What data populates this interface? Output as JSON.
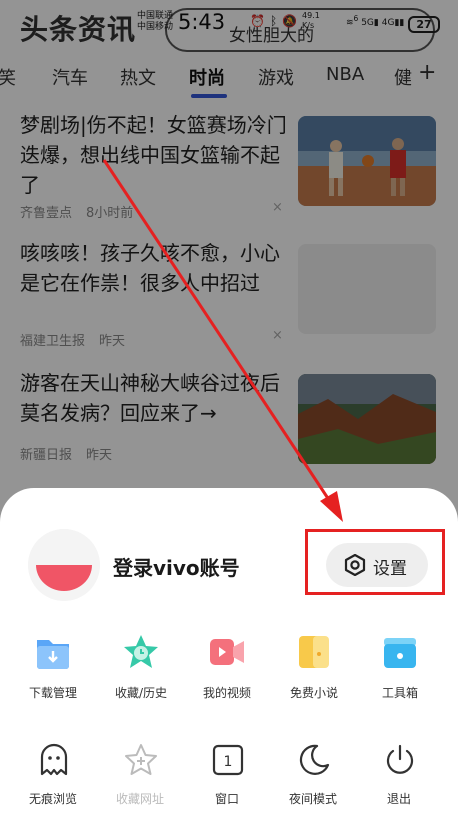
{
  "status_bar": {
    "carrier_1": "中国联通",
    "carrier_2": "中国移动",
    "time": "5:43",
    "net_speed_value": "49.1",
    "net_speed_unit": "K/s",
    "wifi_label": "6",
    "signal_1": "5G",
    "signal_2": "4G",
    "battery": "27"
  },
  "app": {
    "logo": "头条资讯",
    "search_hint": "女性胆大的"
  },
  "tabs": [
    {
      "label": "笑"
    },
    {
      "label": "汽车"
    },
    {
      "label": "热文"
    },
    {
      "label": "时尚"
    },
    {
      "label": "游戏"
    },
    {
      "label": "NBA"
    },
    {
      "label": "健"
    }
  ],
  "tab_plus": "+",
  "articles": [
    {
      "title": "梦剧场|伤不起！女篮赛场冷门迭爆，想出线中国女篮输不起了",
      "source": "齐鲁壹点",
      "time": "8小时前"
    },
    {
      "title": "咳咳咳！孩子久咳不愈，小心是它在作祟！很多人中招过",
      "source": "福建卫生报",
      "time": "昨天"
    },
    {
      "title": "游客在天山神秘大峡谷过夜后莫名发病？回应来了→",
      "source": "新疆日报",
      "time": "昨天"
    }
  ],
  "article_close": "×",
  "sheet": {
    "login_text": "登录vivo账号",
    "settings_label": "设置",
    "row1": [
      {
        "label": "下载管理",
        "icon": "download-folder-icon",
        "color": "#4a9cf5"
      },
      {
        "label": "收藏/历史",
        "icon": "star-clock-icon",
        "color": "#2ec7a6"
      },
      {
        "label": "我的视频",
        "icon": "video-camera-icon",
        "color": "#f25a6a"
      },
      {
        "label": "免费小说",
        "icon": "book-icon",
        "color": "#f7c344"
      },
      {
        "label": "工具箱",
        "icon": "toolbox-icon",
        "color": "#3ab7f0"
      }
    ],
    "row2": [
      {
        "label": "无痕浏览",
        "icon": "ghost-icon",
        "disabled": false
      },
      {
        "label": "收藏网址",
        "icon": "add-bookmark-star-icon",
        "disabled": true
      },
      {
        "label": "窗口",
        "icon": "window-count-icon",
        "count": "1",
        "disabled": false
      },
      {
        "label": "夜间模式",
        "icon": "moon-icon",
        "disabled": false
      },
      {
        "label": "退出",
        "icon": "power-icon",
        "disabled": false
      }
    ]
  },
  "annotation": {
    "color": "#e52121"
  }
}
